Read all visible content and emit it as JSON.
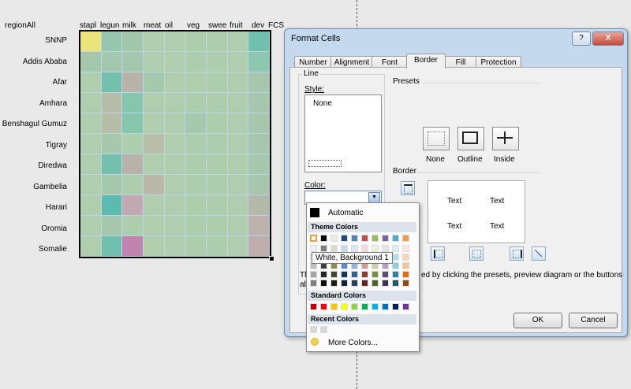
{
  "spreadsheet": {
    "corner_label": "regionAll",
    "columns": [
      "staple",
      "legume",
      "milk",
      "meat",
      "oil",
      "veg",
      "sweet",
      "fruit",
      "dev",
      "FCS"
    ],
    "column_labels_shown": [
      "stapl",
      "legun",
      "milk",
      "meat",
      "oil",
      "veg",
      "swee",
      "fruit",
      "dev",
      "FCS"
    ],
    "rows": [
      "SNNP",
      "Addis Ababa",
      "Afar",
      "Amhara",
      "Benshagul Gumuz",
      "Tigray",
      "Diredwa",
      "Gambelia",
      "Harari",
      "Oromia",
      "Somalie"
    ],
    "heatmap_colors": [
      [
        "#eae47a",
        "#95c6ae",
        "#a3c7ab",
        "#b0cdad",
        "#b0cdad",
        "#aecdad",
        "#aecdad",
        "#b0cdad",
        "#6fc1ad"
      ],
      [
        "#a4c7ad",
        "#a2c9ad",
        "#a4c7ad",
        "#b0cdad",
        "#b0cdad",
        "#aecdad",
        "#aecdad",
        "#b0cdad",
        "#8ec7b0"
      ],
      [
        "#b0cdad",
        "#74c0ad",
        "#b8b2a8",
        "#a4c9ad",
        "#b0cdad",
        "#b0cdad",
        "#aecdad",
        "#b0cdad",
        "#a8c6ae"
      ],
      [
        "#b0cdad",
        "#b6bea8",
        "#86c6ad",
        "#b0cdad",
        "#b0cdad",
        "#aecdad",
        "#aecdad",
        "#b0cdad",
        "#a8c6ae"
      ],
      [
        "#b0cdad",
        "#b6bea8",
        "#86c6ad",
        "#b0cdad",
        "#b0cdad",
        "#a4c9ad",
        "#aecdad",
        "#b0cdad",
        "#a8c6ae"
      ],
      [
        "#b0cdad",
        "#a6c8ad",
        "#aecdad",
        "#bcbfa8",
        "#b0cdad",
        "#aecdad",
        "#aecdad",
        "#b0cdad",
        "#a8c6ae"
      ],
      [
        "#b0cdad",
        "#72c0ad",
        "#b8b2a8",
        "#b0cdad",
        "#b0cdad",
        "#aecdad",
        "#aecdad",
        "#b0cdad",
        "#a8c6ae"
      ],
      [
        "#b0cdad",
        "#a6c8ad",
        "#aecdad",
        "#bab8a8",
        "#b0cdad",
        "#aecdad",
        "#aecdad",
        "#b0cdad",
        "#a8c6ae"
      ],
      [
        "#b0cdad",
        "#5cbaae",
        "#c2a8b0",
        "#b0cdad",
        "#b0cdad",
        "#aecdad",
        "#aecdad",
        "#b0cdad",
        "#b4b8a8"
      ],
      [
        "#b0cdad",
        "#a6c8ad",
        "#aecdad",
        "#b0cdad",
        "#b0cdad",
        "#aecdad",
        "#aecdad",
        "#b0cdad",
        "#bcb2ab"
      ],
      [
        "#b0cdad",
        "#6ebfae",
        "#c283b0",
        "#b0cdad",
        "#b0cdad",
        "#aecdad",
        "#aecdad",
        "#b0cdad",
        "#c0adab"
      ]
    ]
  },
  "dialog": {
    "title": "Format Cells",
    "help_button": "?",
    "close_button": "X",
    "tabs": [
      "Number",
      "Alignment",
      "Font",
      "Border",
      "Fill",
      "Protection"
    ],
    "selected_tab": "Border",
    "line_group": "Line",
    "style_label": "Style:",
    "style_none": "None",
    "color_label": "Color:",
    "presets_label": "Presets",
    "presets": [
      "None",
      "Outline",
      "Inside"
    ],
    "border_label": "Border",
    "preview_text": [
      "Text",
      "Text",
      "Text",
      "Text"
    ],
    "info_text_visible": "ed by clicking the presets, preview diagram or the buttons",
    "info_text_prefix": [
      "Th",
      "ab"
    ],
    "ok": "OK",
    "cancel": "Cancel"
  },
  "color_popup": {
    "automatic": "Automatic",
    "theme_header": "Theme Colors",
    "standard_header": "Standard Colors",
    "recent_header": "Recent Colors",
    "more_colors": "More Colors...",
    "theme_top": [
      "#ffffff",
      "#000000",
      "#eeece1",
      "#1f497d",
      "#4f81bd",
      "#c0504d",
      "#9bbb59",
      "#8064a2",
      "#4bacc6",
      "#f79646"
    ],
    "theme_shades": [
      [
        "#f2f2f2",
        "#7f7f7f",
        "#ddd9c3",
        "#c6d9f0",
        "#dbe5f1",
        "#f2dcdb",
        "#ebf1dd",
        "#e5e0ec",
        "#dbeef3",
        "#fdeada"
      ],
      [
        "#d8d8d8",
        "#595959",
        "#c4bd97",
        "#8db3e2",
        "#b8cce4",
        "#e5b9b7",
        "#d7e3bc",
        "#ccc1d9",
        "#b7dde8",
        "#fbd5b5"
      ],
      [
        "#bfbfbf",
        "#3f3f3f",
        "#938953",
        "#548dd4",
        "#95b3d7",
        "#d99694",
        "#c3d69b",
        "#b2a2c7",
        "#92cddc",
        "#fac08f"
      ],
      [
        "#a5a5a5",
        "#262626",
        "#494429",
        "#17365d",
        "#366092",
        "#953734",
        "#76923c",
        "#5f497a",
        "#31859b",
        "#e36c09"
      ],
      [
        "#7f7f7f",
        "#0c0c0c",
        "#1d1b10",
        "#0f243e",
        "#244061",
        "#632423",
        "#4f6128",
        "#3f3151",
        "#205867",
        "#974806"
      ]
    ],
    "standard": [
      "#c00000",
      "#ff0000",
      "#ffc000",
      "#ffff00",
      "#92d050",
      "#00b050",
      "#00b0f0",
      "#0070c0",
      "#002060",
      "#7030a0"
    ],
    "recent": [
      "#d8d8d8",
      "#d8d8d8"
    ],
    "tooltip": "White, Background 1"
  }
}
